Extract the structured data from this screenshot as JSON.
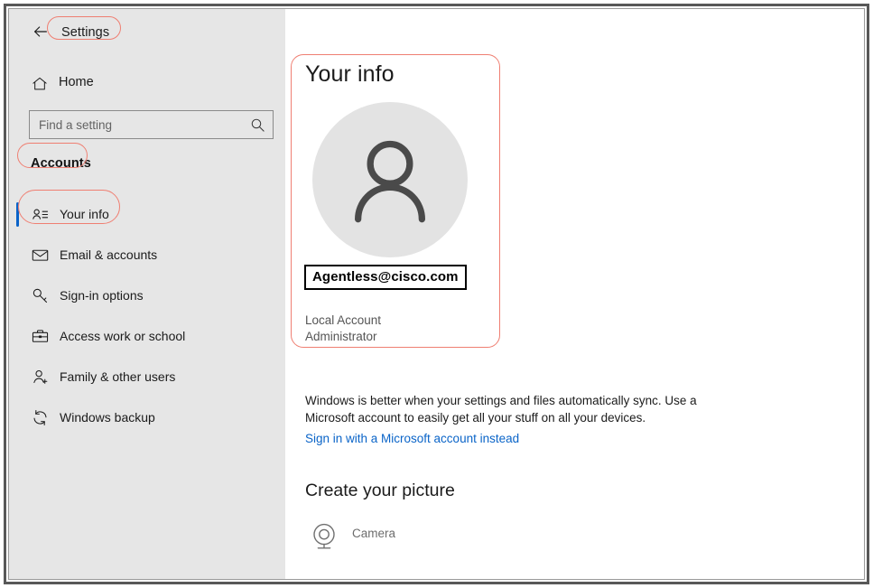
{
  "window": {
    "app_title": "Settings",
    "controls": {
      "minimize": "minimize-button",
      "maximize": "maximize-button",
      "close": "close-button"
    }
  },
  "sidebar": {
    "back_label": "back-arrow",
    "app_name": "Settings",
    "home": {
      "label": "Home",
      "icon": "home-icon"
    },
    "search": {
      "placeholder": "Find a setting",
      "value": "",
      "icon": "search-icon"
    },
    "section_heading": "Accounts",
    "items": [
      {
        "label": "Your info",
        "icon": "user-card-icon",
        "selected": true
      },
      {
        "label": "Email & accounts",
        "icon": "envelope-icon",
        "selected": false
      },
      {
        "label": "Sign-in options",
        "icon": "key-icon",
        "selected": false
      },
      {
        "label": "Access work or school",
        "icon": "briefcase-icon",
        "selected": false
      },
      {
        "label": "Family & other users",
        "icon": "person-add-icon",
        "selected": false
      },
      {
        "label": "Windows backup",
        "icon": "sync-icon",
        "selected": false
      }
    ]
  },
  "main": {
    "page_title": "Your info",
    "avatar_icon": "person-avatar-icon",
    "account_email": "Agentless@cisco.com",
    "account_type_line1": "Local Account",
    "account_type_line2": "Administrator",
    "sync_paragraph": "Windows is better when your settings and files automatically sync. Use a Microsoft account to easily get all your stuff on all your devices.",
    "sync_link": "Sign in with a Microsoft account instead",
    "picture_section_title": "Create your picture",
    "camera": {
      "label": "Camera",
      "icon": "camera-icon"
    }
  },
  "annotations": {
    "color": "#ef7f72",
    "highlight_border": "#000000",
    "accent": "#0a63c9",
    "link_color": "#0a64c8",
    "targets": [
      "Settings",
      "Accounts",
      "Your info",
      "Your info panel"
    ]
  }
}
